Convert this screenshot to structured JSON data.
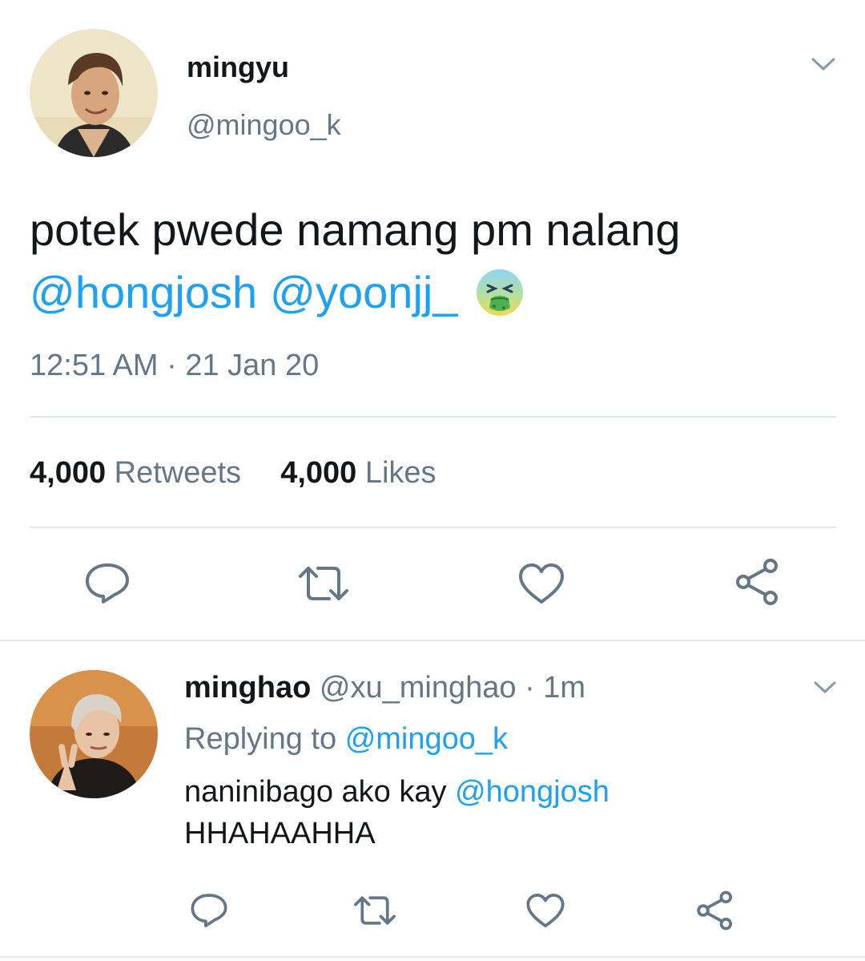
{
  "tweet": {
    "display_name": "mingyu",
    "handle": "@mingoo_k",
    "text": {
      "line1": "potek pwede namang pm nalang",
      "mention1": "@hongjosh",
      "mention2": "@yoonjj_",
      "emoji": "nauseated-face-emoji"
    },
    "timestamp": "12:51 AM · 21 Jan 20",
    "stats": {
      "retweets_count": "4,000",
      "retweets_label": "Retweets",
      "likes_count": "4,000",
      "likes_label": "Likes"
    }
  },
  "reply": {
    "display_name": "minghao",
    "handle": "@xu_minghao",
    "time": "· 1m",
    "replying_prefix": "Replying to",
    "replying_to": "@mingoo_k",
    "text_start": "naninibago ako kay",
    "text_mention": "@hongjosh",
    "text_line2": "HHAHAAHHA"
  },
  "colors": {
    "link_blue": "#1da1f2",
    "secondary_gray": "#657786",
    "icon_gray": "#657786",
    "divider": "#e1e8ed"
  }
}
